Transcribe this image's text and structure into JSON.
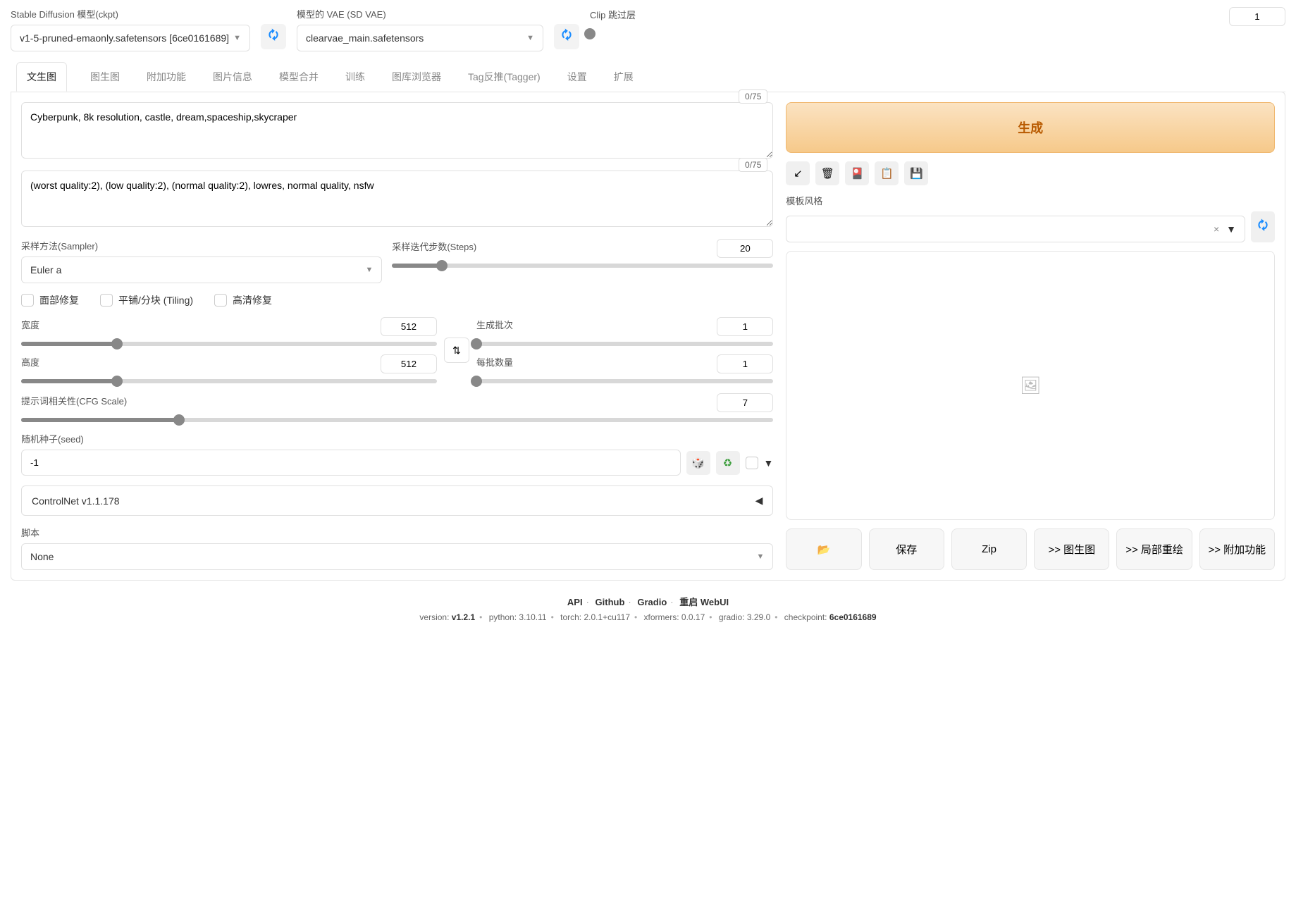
{
  "top": {
    "model_label": "Stable Diffusion 模型(ckpt)",
    "model_value": "v1-5-pruned-emaonly.safetensors [6ce0161689]",
    "vae_label": "模型的 VAE (SD VAE)",
    "vae_value": "clearvae_main.safetensors",
    "clip_label": "Clip 跳过层",
    "clip_value": "1"
  },
  "tabs": [
    "文生图",
    "图生图",
    "附加功能",
    "图片信息",
    "模型合并",
    "训练",
    "图库浏览器",
    "Tag反推(Tagger)",
    "设置",
    "扩展"
  ],
  "prompt": {
    "positive": "Cyberpunk, 8k resolution, castle, dream,spaceship,skycraper",
    "pos_counter": "0/75",
    "negative": "(worst quality:2), (low quality:2), (normal quality:2), lowres, normal quality, nsfw",
    "neg_counter": "0/75"
  },
  "generate_label": "生成",
  "style": {
    "label": "模板风格",
    "clear": "×"
  },
  "sampler": {
    "label": "采样方法(Sampler)",
    "value": "Euler a"
  },
  "steps": {
    "label": "采样迭代步数(Steps)",
    "value": "20"
  },
  "checks": {
    "face": "面部修复",
    "tiling": "平铺/分块 (Tiling)",
    "hires": "高清修复"
  },
  "width": {
    "label": "宽度",
    "value": "512"
  },
  "height": {
    "label": "高度",
    "value": "512"
  },
  "batch_count": {
    "label": "生成批次",
    "value": "1"
  },
  "batch_size": {
    "label": "每批数量",
    "value": "1"
  },
  "cfg": {
    "label": "提示词相关性(CFG Scale)",
    "value": "7"
  },
  "seed": {
    "label": "随机种子(seed)",
    "value": "-1"
  },
  "controlnet": "ControlNet v1.1.178",
  "script": {
    "label": "脚本",
    "value": "None"
  },
  "outputs": {
    "folder": "📂",
    "save": "保存",
    "zip": "Zip",
    "img2img": ">> 图生图",
    "inpaint": ">> 局部重绘",
    "extras": ">> 附加功能"
  },
  "footer": {
    "api": "API",
    "github": "Github",
    "gradio": "Gradio",
    "restart": "重启 WebUI",
    "version_l": "version:",
    "version_v": "v1.2.1",
    "python_l": "python:",
    "python_v": "3.10.11",
    "torch_l": "torch:",
    "torch_v": "2.0.1+cu117",
    "xformers_l": "xformers:",
    "xformers_v": "0.0.17",
    "gradio_l": "gradio:",
    "gradio_v": "3.29.0",
    "ckpt_l": "checkpoint:",
    "ckpt_v": "6ce0161689"
  }
}
